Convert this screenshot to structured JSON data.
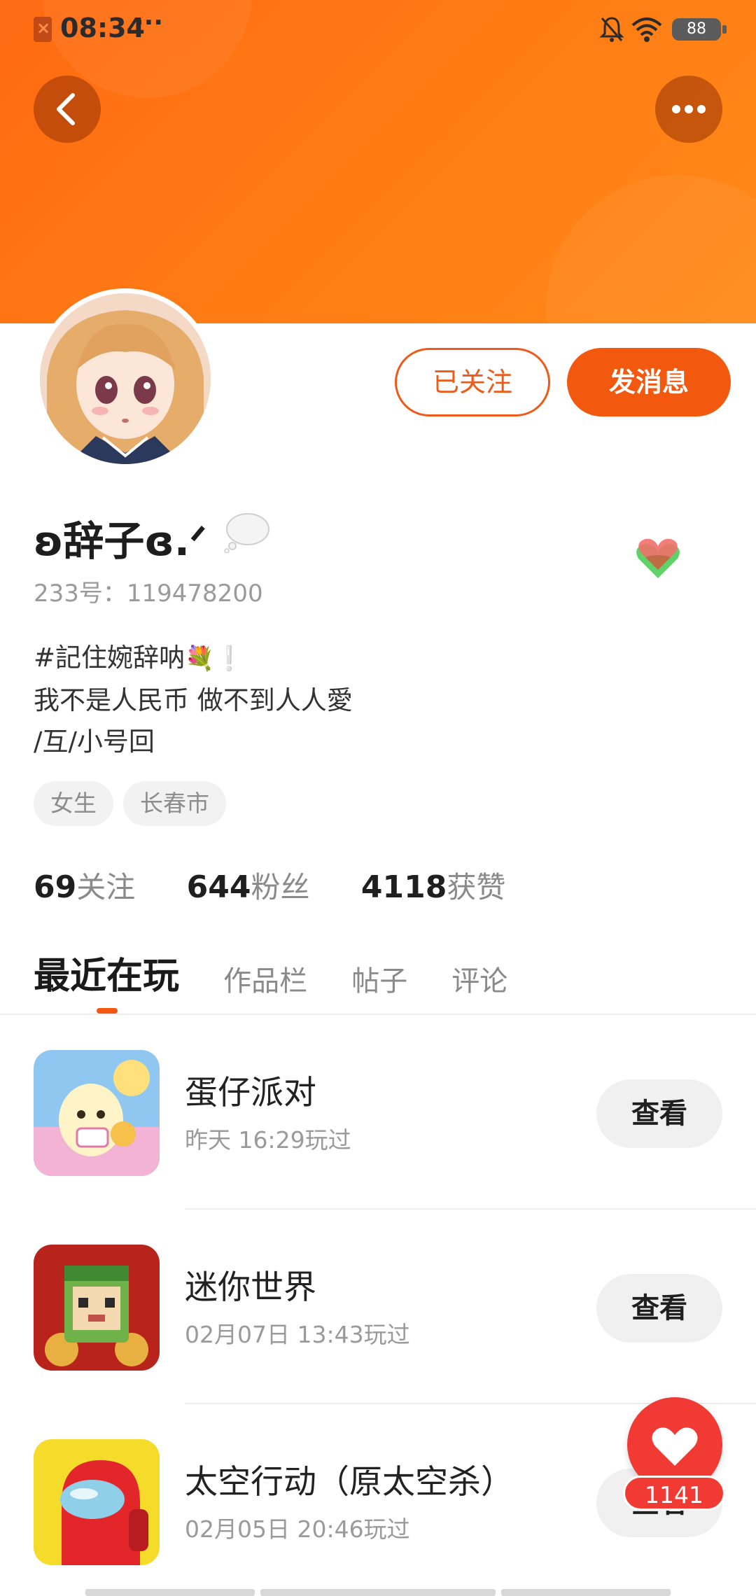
{
  "status_bar": {
    "time": "08:34",
    "more": "···",
    "battery": "88"
  },
  "profile": {
    "followed_label": "已关注",
    "message_label": "发消息",
    "username": "ʚ辞子ɞ.ᐟ",
    "uid": "233号：119478200",
    "bio": [
      "#記住婉辞呐",
      "我不是人民币 做不到人人愛",
      "/互/小号回"
    ],
    "tags": [
      "女生",
      "长春市"
    ]
  },
  "stats": [
    {
      "num": "69",
      "label": "关注"
    },
    {
      "num": "644",
      "label": "粉丝"
    },
    {
      "num": "4118",
      "label": "获赞"
    }
  ],
  "tabs": [
    "最近在玩",
    "作品栏",
    "帖子",
    "评论"
  ],
  "games": [
    {
      "name": "蛋仔派对",
      "time": "昨天 16:29玩过",
      "view": "查看"
    },
    {
      "name": "迷你世界",
      "time": "02月07日 13:43玩过",
      "view": "查看"
    },
    {
      "name": "太空行动（原太空杀）",
      "time": "02月05日 20:46玩过",
      "view": "查看"
    }
  ],
  "float_like": {
    "count": "1141"
  },
  "colors": {
    "accent": "#f2590f",
    "banner": "#ff7a14",
    "like": "#f23a35"
  },
  "icons": [
    "back-icon",
    "more-icon",
    "bell-off-icon",
    "wifi-icon",
    "battery-icon",
    "bubble-icon",
    "heart-badge-icon",
    "heart-icon"
  ]
}
